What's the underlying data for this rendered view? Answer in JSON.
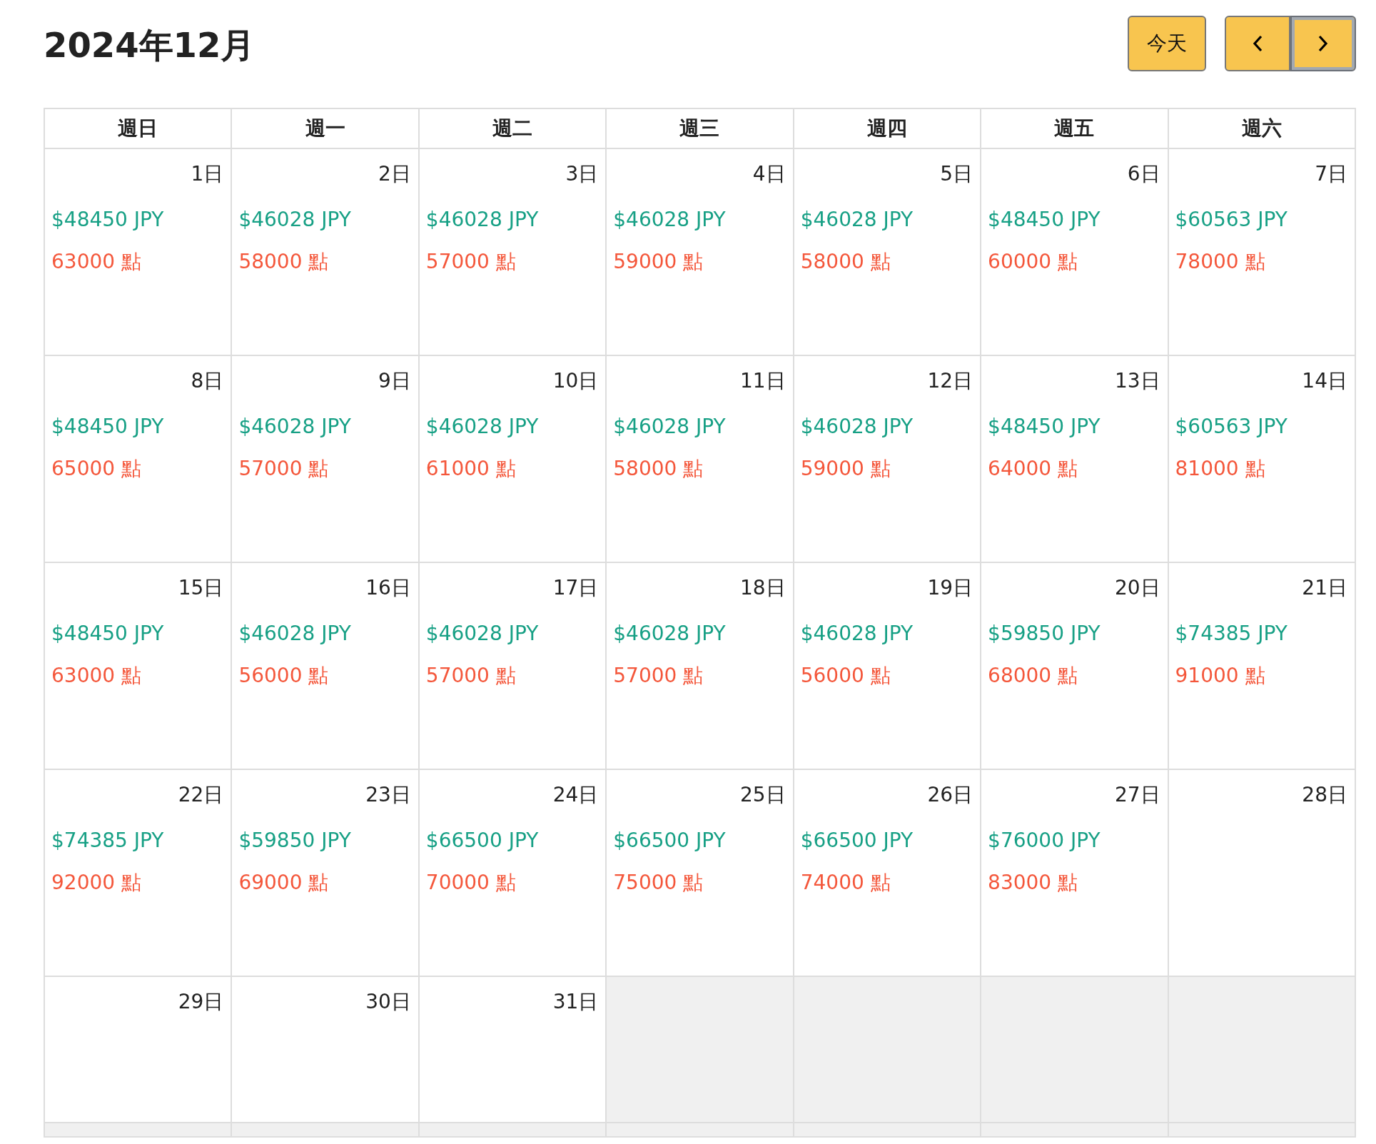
{
  "title": "2024年12月",
  "buttons": [
    {
      "kind": "today",
      "label": "今天",
      "focused": false
    },
    {
      "kind": "prev",
      "focused": false
    },
    {
      "kind": "next",
      "focused": true
    }
  ],
  "weekdays": [
    "週日",
    "週一",
    "週二",
    "週三",
    "週四",
    "週五",
    "週六"
  ],
  "weeks": [
    [
      {
        "kind": "day",
        "day": "1日",
        "price": "$48450 JPY",
        "points": "63000 點"
      },
      {
        "kind": "day",
        "day": "2日",
        "price": "$46028 JPY",
        "points": "58000 點"
      },
      {
        "kind": "day",
        "day": "3日",
        "price": "$46028 JPY",
        "points": "57000 點"
      },
      {
        "kind": "day",
        "day": "4日",
        "price": "$46028 JPY",
        "points": "59000 點"
      },
      {
        "kind": "day",
        "day": "5日",
        "price": "$46028 JPY",
        "points": "58000 點"
      },
      {
        "kind": "day",
        "day": "6日",
        "price": "$48450 JPY",
        "points": "60000 點"
      },
      {
        "kind": "day",
        "day": "7日",
        "price": "$60563 JPY",
        "points": "78000 點"
      }
    ],
    [
      {
        "kind": "day",
        "day": "8日",
        "price": "$48450 JPY",
        "points": "65000 點"
      },
      {
        "kind": "day",
        "day": "9日",
        "price": "$46028 JPY",
        "points": "57000 點"
      },
      {
        "kind": "day",
        "day": "10日",
        "price": "$46028 JPY",
        "points": "61000 點"
      },
      {
        "kind": "day",
        "day": "11日",
        "price": "$46028 JPY",
        "points": "58000 點"
      },
      {
        "kind": "day",
        "day": "12日",
        "price": "$46028 JPY",
        "points": "59000 點"
      },
      {
        "kind": "day",
        "day": "13日",
        "price": "$48450 JPY",
        "points": "64000 點"
      },
      {
        "kind": "day",
        "day": "14日",
        "price": "$60563 JPY",
        "points": "81000 點"
      }
    ],
    [
      {
        "kind": "day",
        "day": "15日",
        "price": "$48450 JPY",
        "points": "63000 點"
      },
      {
        "kind": "day",
        "day": "16日",
        "price": "$46028 JPY",
        "points": "56000 點"
      },
      {
        "kind": "day",
        "day": "17日",
        "price": "$46028 JPY",
        "points": "57000 點"
      },
      {
        "kind": "day",
        "day": "18日",
        "price": "$46028 JPY",
        "points": "57000 點"
      },
      {
        "kind": "day",
        "day": "19日",
        "price": "$46028 JPY",
        "points": "56000 點"
      },
      {
        "kind": "day",
        "day": "20日",
        "price": "$59850 JPY",
        "points": "68000 點"
      },
      {
        "kind": "day",
        "day": "21日",
        "price": "$74385 JPY",
        "points": "91000 點"
      }
    ],
    [
      {
        "kind": "day",
        "day": "22日",
        "price": "$74385 JPY",
        "points": "92000 點"
      },
      {
        "kind": "day",
        "day": "23日",
        "price": "$59850 JPY",
        "points": "69000 點"
      },
      {
        "kind": "day",
        "day": "24日",
        "price": "$66500 JPY",
        "points": "70000 點"
      },
      {
        "kind": "day",
        "day": "25日",
        "price": "$66500 JPY",
        "points": "75000 點"
      },
      {
        "kind": "day",
        "day": "26日",
        "price": "$66500 JPY",
        "points": "74000 點"
      },
      {
        "kind": "day",
        "day": "27日",
        "price": "$76000 JPY",
        "points": "83000 點"
      },
      {
        "kind": "day",
        "day": "28日"
      }
    ],
    [
      {
        "kind": "day",
        "day": "29日"
      },
      {
        "kind": "day",
        "day": "30日"
      },
      {
        "kind": "day",
        "day": "31日"
      },
      {
        "kind": "other"
      },
      {
        "kind": "other"
      },
      {
        "kind": "other"
      },
      {
        "kind": "other"
      }
    ],
    [
      {
        "kind": "other"
      },
      {
        "kind": "other"
      },
      {
        "kind": "other"
      },
      {
        "kind": "other"
      },
      {
        "kind": "other"
      },
      {
        "kind": "other"
      },
      {
        "kind": "other"
      }
    ]
  ]
}
